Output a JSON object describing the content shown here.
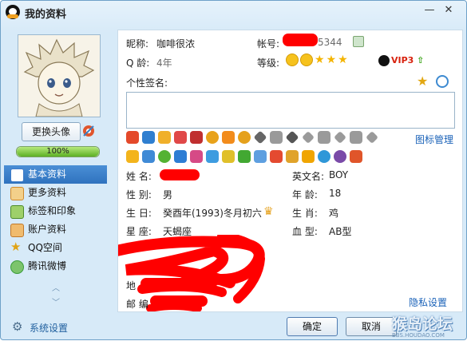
{
  "window": {
    "title": "我的资料",
    "minimize_glyph": "—",
    "close_glyph": "✕"
  },
  "sidebar": {
    "change_avatar_label": "更换头像",
    "completion_text": "100%",
    "completion": 1.0,
    "items": [
      {
        "label": "基本资料",
        "icon": "profile-card-icon",
        "color": "#3e7cc9",
        "active": true
      },
      {
        "label": "更多资料",
        "icon": "more-info-icon",
        "color": "#d08a2c",
        "active": false
      },
      {
        "label": "标签和印象",
        "icon": "tag-icon",
        "color": "#4d8b2a",
        "active": false
      },
      {
        "label": "账户资料",
        "icon": "account-icon",
        "color": "#c0782a",
        "active": false
      },
      {
        "label": "QQ空间",
        "icon": "qzone-star-icon",
        "color": "#e0a315",
        "active": false
      },
      {
        "label": "腾讯微博",
        "icon": "weibo-icon",
        "color": "#3b9d3b",
        "active": false
      }
    ]
  },
  "profile": {
    "nickname_label": "昵称:",
    "nickname": "咖啡很浓",
    "account_label": "帐号:",
    "account_suffix": "5344",
    "qage_label": "Q 龄:",
    "qage": "4年",
    "level_label": "等级:",
    "vip_label": "VIP3",
    "signature_label": "个性签名:",
    "signature": "",
    "badge_manage_label": "图标管理"
  },
  "details": {
    "name_label": "姓    名:",
    "english_name_label": "英文名:",
    "english_name": "BOY",
    "gender_label": "性    别:",
    "gender": "男",
    "age_label": "年    龄:",
    "age": "18",
    "birthday_label": "生    日:",
    "birthday": "癸酉年(1993)冬月初六",
    "zodiac_label": "生    肖:",
    "zodiac": "鸡",
    "constellation_label": "星    座:",
    "constellation": "天蝎座",
    "blood_label": "血    型:",
    "blood": "AB型",
    "address_label": "地",
    "postcode_label": "邮    编",
    "privacy_label": "隐私设置"
  },
  "footer": {
    "settings_label": "系统设置",
    "ok_label": "确定",
    "cancel_label": "取消"
  },
  "watermark": {
    "title": "猴岛论坛",
    "url": "BBS.HOUDAO.COM"
  },
  "colors": {
    "accent": "#2f72be",
    "link": "#1a62b8",
    "redaction": "#ff0000"
  }
}
